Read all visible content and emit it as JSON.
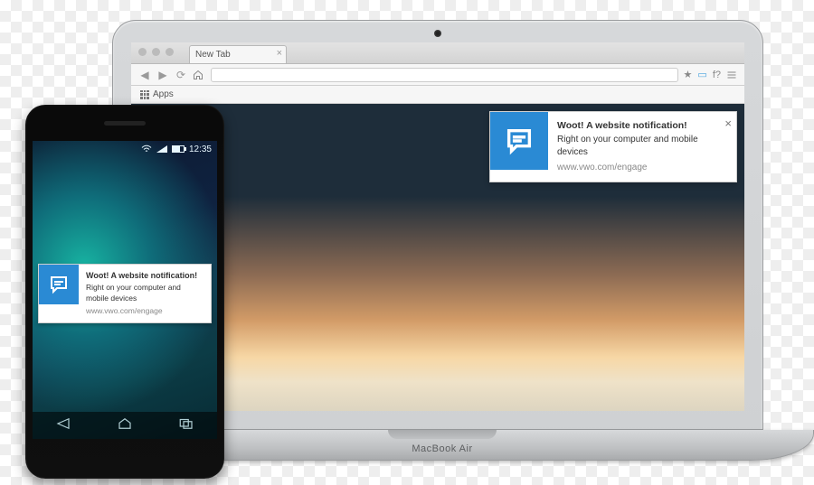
{
  "laptop": {
    "brand_label": "MacBook Air",
    "browser": {
      "tab_label": "New Tab",
      "bookmark_bar": {
        "apps_label": "Apps"
      },
      "toolbar_icons": {
        "fx": "f?"
      }
    }
  },
  "phone": {
    "status": {
      "time": "12:35"
    }
  },
  "notification": {
    "title": "Woot! A website notification!",
    "body": "Right on your computer and mobile devices",
    "source": "www.vwo.com/engage"
  }
}
